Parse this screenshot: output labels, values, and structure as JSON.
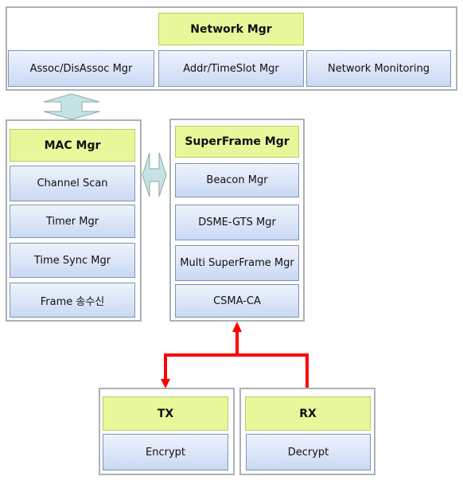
{
  "network": {
    "title": "Network Mgr",
    "items": [
      "Assoc/DisAssoc Mgr",
      "Addr/TimeSlot Mgr",
      "Network Monitoring"
    ]
  },
  "mac": {
    "title": "MAC Mgr",
    "items": [
      "Channel Scan",
      "Timer Mgr",
      "Time Sync Mgr",
      "Frame 송수신"
    ]
  },
  "superframe": {
    "title": "SuperFrame Mgr",
    "items": [
      "Beacon Mgr",
      "DSME-GTS Mgr",
      "Multi SuperFrame Mgr",
      "CSMA-CA"
    ]
  },
  "tx": {
    "title": "TX",
    "items": [
      "Encrypt"
    ]
  },
  "rx": {
    "title": "RX",
    "items": [
      "Decrypt"
    ]
  },
  "colors": {
    "header": "#e8f79a",
    "module": "#c9d9f3",
    "link": "#ff0000",
    "bidir_arrow": "#c5e3e3"
  }
}
